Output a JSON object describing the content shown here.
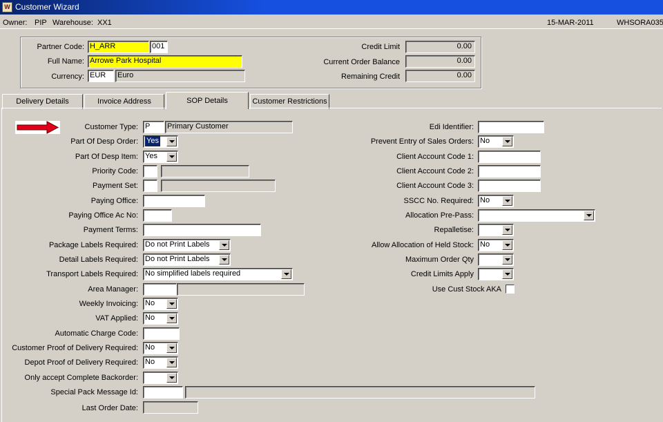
{
  "window": {
    "title": "Customer Wizard",
    "icon": "app-icon"
  },
  "infobar": {
    "owner_label": "Owner:",
    "owner": "PIP",
    "warehouse_label": "Warehouse:",
    "warehouse": "XX1",
    "date": "15-MAR-2011",
    "db": "WHSORA035"
  },
  "header": {
    "partner_code_label": "Partner Code:",
    "partner_code": "H_ARR",
    "partner_suffix": "001",
    "full_name_label": "Full Name:",
    "full_name": "Arrowe Park Hospital",
    "currency_label": "Currency:",
    "currency_code": "EUR",
    "currency_name": "Euro",
    "credit_limit_label": "Credit Limit",
    "credit_limit": "0.00",
    "current_order_balance_label": "Current Order Balance",
    "current_order_balance": "0.00",
    "remaining_credit_label": "Remaining Credit",
    "remaining_credit": "0.00"
  },
  "tabs": [
    {
      "label": "Delivery Details"
    },
    {
      "label": "Invoice Address"
    },
    {
      "label": "SOP Details"
    },
    {
      "label": "Customer Restrictions"
    }
  ],
  "active_tab": "SOP Details",
  "colors": {
    "highlight": "#ffff00",
    "title_bar": "#1550e0",
    "arrow": "#e0001a"
  },
  "left": {
    "customer_type_label": "Customer Type:",
    "customer_type_code": "P",
    "customer_type_desc": "Primary Customer",
    "part_of_desp_order_label": "Part Of Desp Order:",
    "part_of_desp_order": "Yes",
    "part_of_desp_item_label": "Part Of Desp Item:",
    "part_of_desp_item": "Yes",
    "priority_code_label": "Priority Code:",
    "priority_code": "",
    "priority_desc": "",
    "payment_set_label": "Payment Set:",
    "payment_set": "",
    "payment_set_desc": "",
    "paying_office_label": "Paying Office:",
    "paying_office": "",
    "paying_office_ac_label": "Paying Office Ac No:",
    "paying_office_ac": "",
    "payment_terms_label": "Payment Terms:",
    "payment_terms": "",
    "package_labels_label": "Package Labels Required:",
    "package_labels": "Do not Print Labels",
    "detail_labels_label": "Detail Labels Required:",
    "detail_labels": "Do not Print Labels",
    "transport_labels_label": "Transport Labels Required:",
    "transport_labels": "No simplified labels required",
    "area_manager_label": "Area Manager:",
    "area_manager": "",
    "area_manager_desc": "",
    "weekly_invoicing_label": "Weekly Invoicing:",
    "weekly_invoicing": "No",
    "vat_applied_label": "VAT Applied:",
    "vat_applied": "No",
    "auto_charge_label": "Automatic Charge Code:",
    "auto_charge": "",
    "cust_pod_label": "Customer Proof of Delivery Required:",
    "cust_pod": "No",
    "depot_pod_label": "Depot Proof of Delivery Required:",
    "depot_pod": "No",
    "complete_backorder_label": "Only accept Complete Backorder:",
    "complete_backorder": "",
    "special_pack_label": "Special Pack Message Id:",
    "special_pack": "",
    "special_pack_desc": "",
    "last_order_date_label": "Last Order Date:",
    "last_order_date": ""
  },
  "right": {
    "edi_identifier_label": "Edi Identifier:",
    "edi_identifier": "",
    "prevent_entry_label": "Prevent Entry of Sales Orders:",
    "prevent_entry": "No",
    "client_ac1_label": "Client Account Code 1:",
    "client_ac1": "",
    "client_ac2_label": "Client Account Code 2:",
    "client_ac2": "",
    "client_ac3_label": "Client Account Code 3:",
    "client_ac3": "",
    "sscc_label": "SSCC No. Required:",
    "sscc": "No",
    "allocation_prepass_label": "Allocation Pre-Pass:",
    "allocation_prepass": "",
    "repalletise_label": "Repalletise:",
    "repalletise": "",
    "allow_held_label": "Allow Allocation of Held Stock:",
    "allow_held": "No",
    "max_order_qty_label": "Maximum Order Qty",
    "max_order_qty": "",
    "credit_limits_label": "Credit Limits Apply",
    "credit_limits": "",
    "use_cust_stock_label": "Use Cust Stock AKA"
  }
}
